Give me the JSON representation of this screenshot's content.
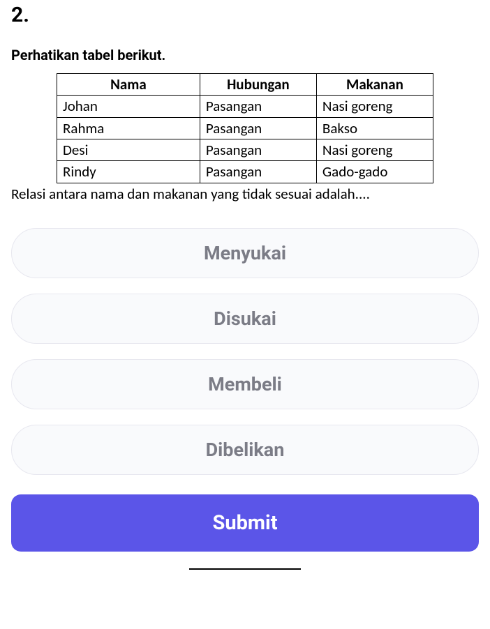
{
  "question_number": "2.",
  "instruction": "Perhatikan tabel berikut.",
  "table": {
    "headers": [
      "Nama",
      "Hubungan",
      "Makanan"
    ],
    "rows": [
      [
        "Johan",
        "Pasangan",
        "Nasi goreng"
      ],
      [
        "Rahma",
        "Pasangan",
        "Bakso"
      ],
      [
        "Desi",
        "Pasangan",
        "Nasi goreng"
      ],
      [
        "Rindy",
        "Pasangan",
        "Gado-gado"
      ]
    ]
  },
  "question_text": "Relasi antara nama dan makanan yang tidak sesuai adalah....",
  "options": [
    "Menyukai",
    "Disukai",
    "Membeli",
    "Dibelikan"
  ],
  "submit_label": "Submit"
}
